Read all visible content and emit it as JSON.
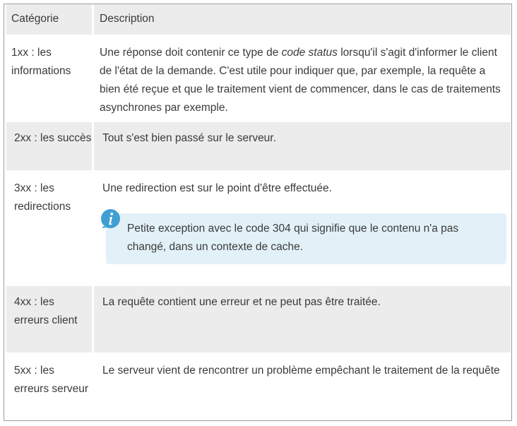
{
  "table": {
    "headers": [
      "Catégorie",
      "Description"
    ],
    "rows": [
      {
        "category": "1xx : les informations",
        "description_before": "Une réponse doit contenir ce type de ",
        "description_em": "code status",
        "description_after": " lorsqu'il s'agit d'informer le client de l'état de la demande. C'est utile pour indiquer que, par exemple, la requête a bien été reçue et que le traitement vient de commencer, dans le cas de traitements asynchrones par exemple."
      },
      {
        "category": "2xx : les succès",
        "description": "Tout s'est bien passé sur le serveur."
      },
      {
        "category": "3xx : les redirections",
        "description": "Une redirection est sur le point d'être effectuée.",
        "note": "Petite exception avec le code 304 qui signifie que le contenu n'a pas changé, dans un contexte de cache.",
        "note_icon": "info-icon"
      },
      {
        "category": "4xx : les erreurs client",
        "description": "La requête contient une erreur et ne peut pas être traitée."
      },
      {
        "category": "5xx : les erreurs serveur",
        "description": "Le serveur vient de rencontrer un problème empêchant le traitement de la requête"
      }
    ]
  },
  "colors": {
    "header_bg": "#ececec",
    "note_bg": "#e2f1f8",
    "icon": "#3f9fd2"
  }
}
